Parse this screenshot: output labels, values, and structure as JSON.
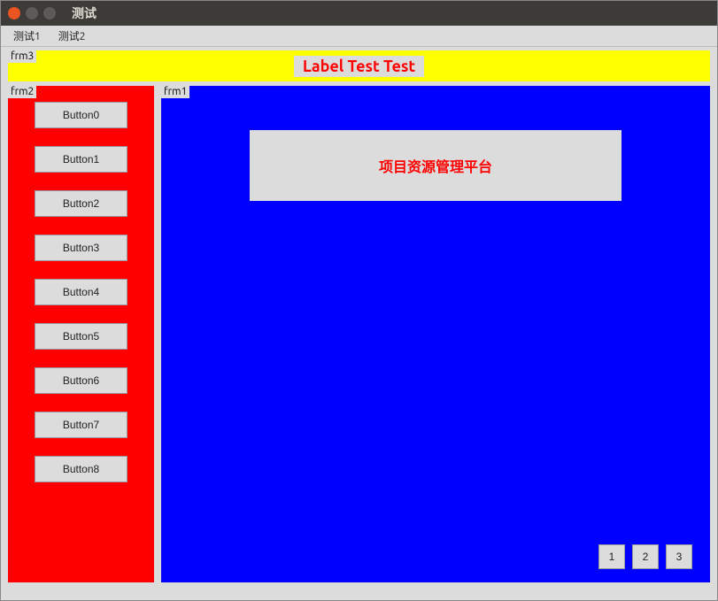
{
  "window": {
    "title": "测试"
  },
  "menu": {
    "items": [
      "测试1",
      "测试2"
    ]
  },
  "frm3": {
    "label": "frm3",
    "text": "Label Test Test"
  },
  "frm2": {
    "label": "frm2",
    "buttons": [
      "Button0",
      "Button1",
      "Button2",
      "Button3",
      "Button4",
      "Button5",
      "Button6",
      "Button7",
      "Button8"
    ]
  },
  "frm1": {
    "label": "frm1",
    "box_text": "项目资源管理平台",
    "bottom_buttons": [
      "1",
      "2",
      "3"
    ]
  },
  "colors": {
    "frm3_bg": "#ffff00",
    "frm2_bg": "#ff0000",
    "frm1_bg": "#0000ff",
    "accent_text": "#ff0000"
  }
}
